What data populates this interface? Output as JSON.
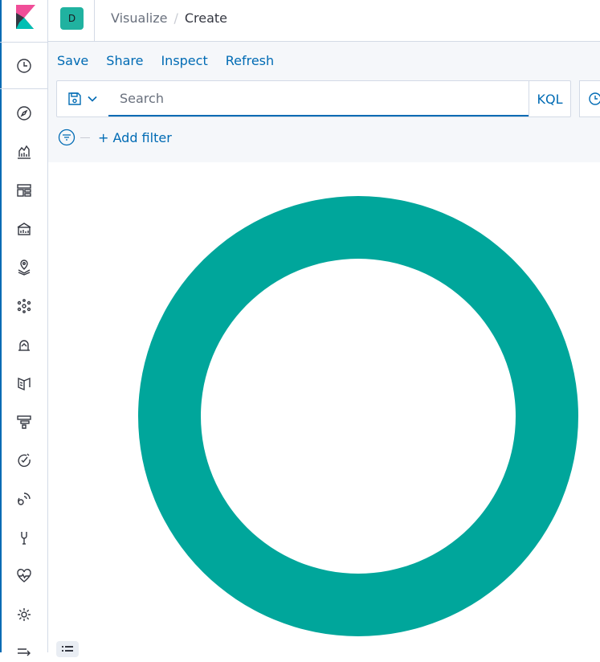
{
  "header": {
    "space_initial": "D",
    "breadcrumbs": [
      {
        "label": "Visualize"
      },
      {
        "label": "Create"
      }
    ]
  },
  "menu": {
    "items": [
      "Save",
      "Share",
      "Inspect",
      "Refresh"
    ]
  },
  "query_bar": {
    "search_placeholder": "Search",
    "search_value": "",
    "language": "KQL"
  },
  "filter_bar": {
    "add_filter_label": "+ Add filter"
  },
  "nav": {
    "icons": [
      "clock-icon",
      "compass-icon",
      "visualize-icon",
      "dashboard-icon",
      "canvas-icon",
      "maps-icon",
      "ml-icon",
      "metrics-icon",
      "logs-icon",
      "apm-icon",
      "uptime-icon",
      "siem-icon",
      "devtools-icon",
      "monitoring-icon",
      "management-icon",
      "collapse-icon"
    ]
  },
  "colors": {
    "accent": "#006bb4",
    "slice": "#00a69b",
    "space_badge": "#20b2a0"
  },
  "chart_data": {
    "type": "pie",
    "donut": true,
    "categories": [
      ""
    ],
    "values": [
      100
    ],
    "colors": [
      "#00a69b"
    ]
  }
}
